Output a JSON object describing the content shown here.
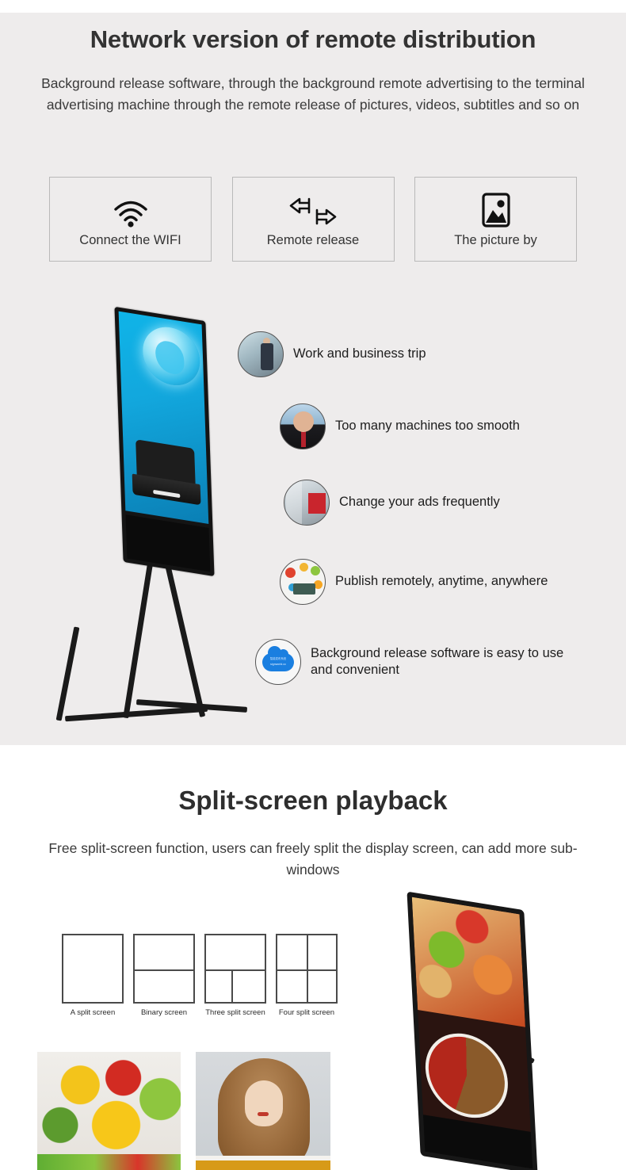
{
  "section1": {
    "title": "Network version of remote distribution",
    "subtitle": "Background release software, through the background remote advertising to the terminal advertising machine through the remote release of pictures, videos, subtitles and so on",
    "features": [
      {
        "icon": "wifi-icon",
        "label": "Connect the WIFI"
      },
      {
        "icon": "exchange-arrows-icon",
        "label": "Remote release"
      },
      {
        "icon": "picture-icon",
        "label": "The picture by"
      }
    ],
    "bullets": [
      {
        "thumb": "office-worker-thumb",
        "text": "Work and business trip"
      },
      {
        "thumb": "stressed-man-thumb",
        "text": "Too many machines too smooth"
      },
      {
        "thumb": "airport-display-thumb",
        "text": "Change your ads frequently"
      },
      {
        "thumb": "publish-network-thumb",
        "text": "Publish remotely, anytime, anywhere"
      },
      {
        "thumb": "cloud-logo-thumb",
        "text": "Background release software is easy to use and convenient"
      }
    ],
    "cloud_badge": {
      "cn_text": "智能发布系统",
      "url": "signworld.cc"
    },
    "kiosk_alt": "portable-digital-signage-globe-laptop"
  },
  "section2": {
    "title": "Split-screen playback",
    "subtitle": "Free split-screen function, users can freely split the display screen, can add more sub-windows",
    "split_modes": [
      {
        "label": "A split screen",
        "panes": 1
      },
      {
        "label": "Binary screen",
        "panes": 2
      },
      {
        "label": "Three split screen",
        "panes": 3
      },
      {
        "label": "Four split screen",
        "panes": 4
      }
    ],
    "photos": [
      {
        "name": "vegetables-photo"
      },
      {
        "name": "woman-portrait-photo"
      }
    ],
    "kiosk_alt": "portable-digital-signage-hotpot-food"
  },
  "colors": {
    "panel_bg": "#eeecec",
    "page_bg": "#ffffff",
    "heading": "#333333",
    "body_text": "#3a3a3a",
    "box_border": "#b9b9b9",
    "cloud_blue": "#1a7fe0"
  }
}
